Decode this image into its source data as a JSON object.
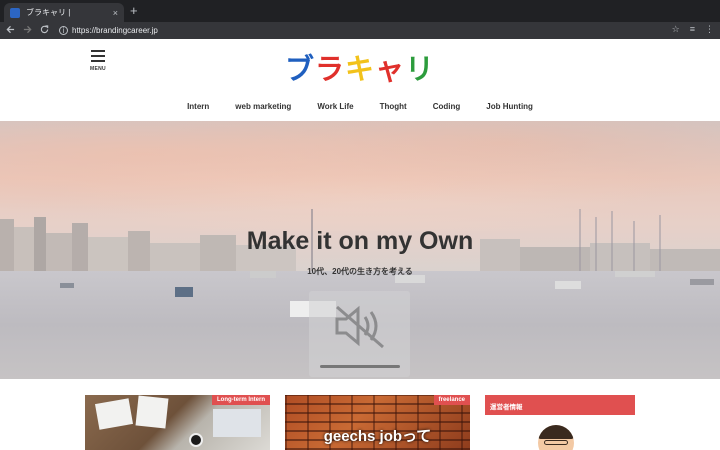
{
  "browser": {
    "tab_title": "ブラキャリ |",
    "tab_close": "×",
    "new_tab": "+",
    "url": "https://brandingcareer.jp"
  },
  "header": {
    "menu_label": "MENU",
    "logo_chars": [
      {
        "char": "ブ",
        "color": "#1f5fbf"
      },
      {
        "char": "ラ",
        "color": "#e0302b"
      },
      {
        "char": "キ",
        "color": "#f2c21b"
      },
      {
        "char": "ャ",
        "color": "#e0302b"
      },
      {
        "char": "リ",
        "color": "#2c9c3c"
      }
    ],
    "nav": [
      "Intern",
      "web marketing",
      "Work Life",
      "Thoght",
      "Coding",
      "Job Hunting"
    ]
  },
  "hero": {
    "title": "Make it on my Own",
    "subtitle": "10代、20代の生き方を考える"
  },
  "cards": [
    {
      "badge": "Long-term Intern"
    },
    {
      "badge": "freelance",
      "text": "geechs jobって"
    }
  ],
  "sidebar": {
    "widget_title": "運営者情報"
  },
  "icons": {
    "back": "arrow-left-icon",
    "forward": "arrow-right-icon",
    "reload": "reload-icon",
    "info": "info-icon",
    "star": "star-icon",
    "extension": "extension-icon",
    "more": "more-vert-icon",
    "mute": "volume-mute-icon",
    "menu": "hamburger-icon"
  }
}
